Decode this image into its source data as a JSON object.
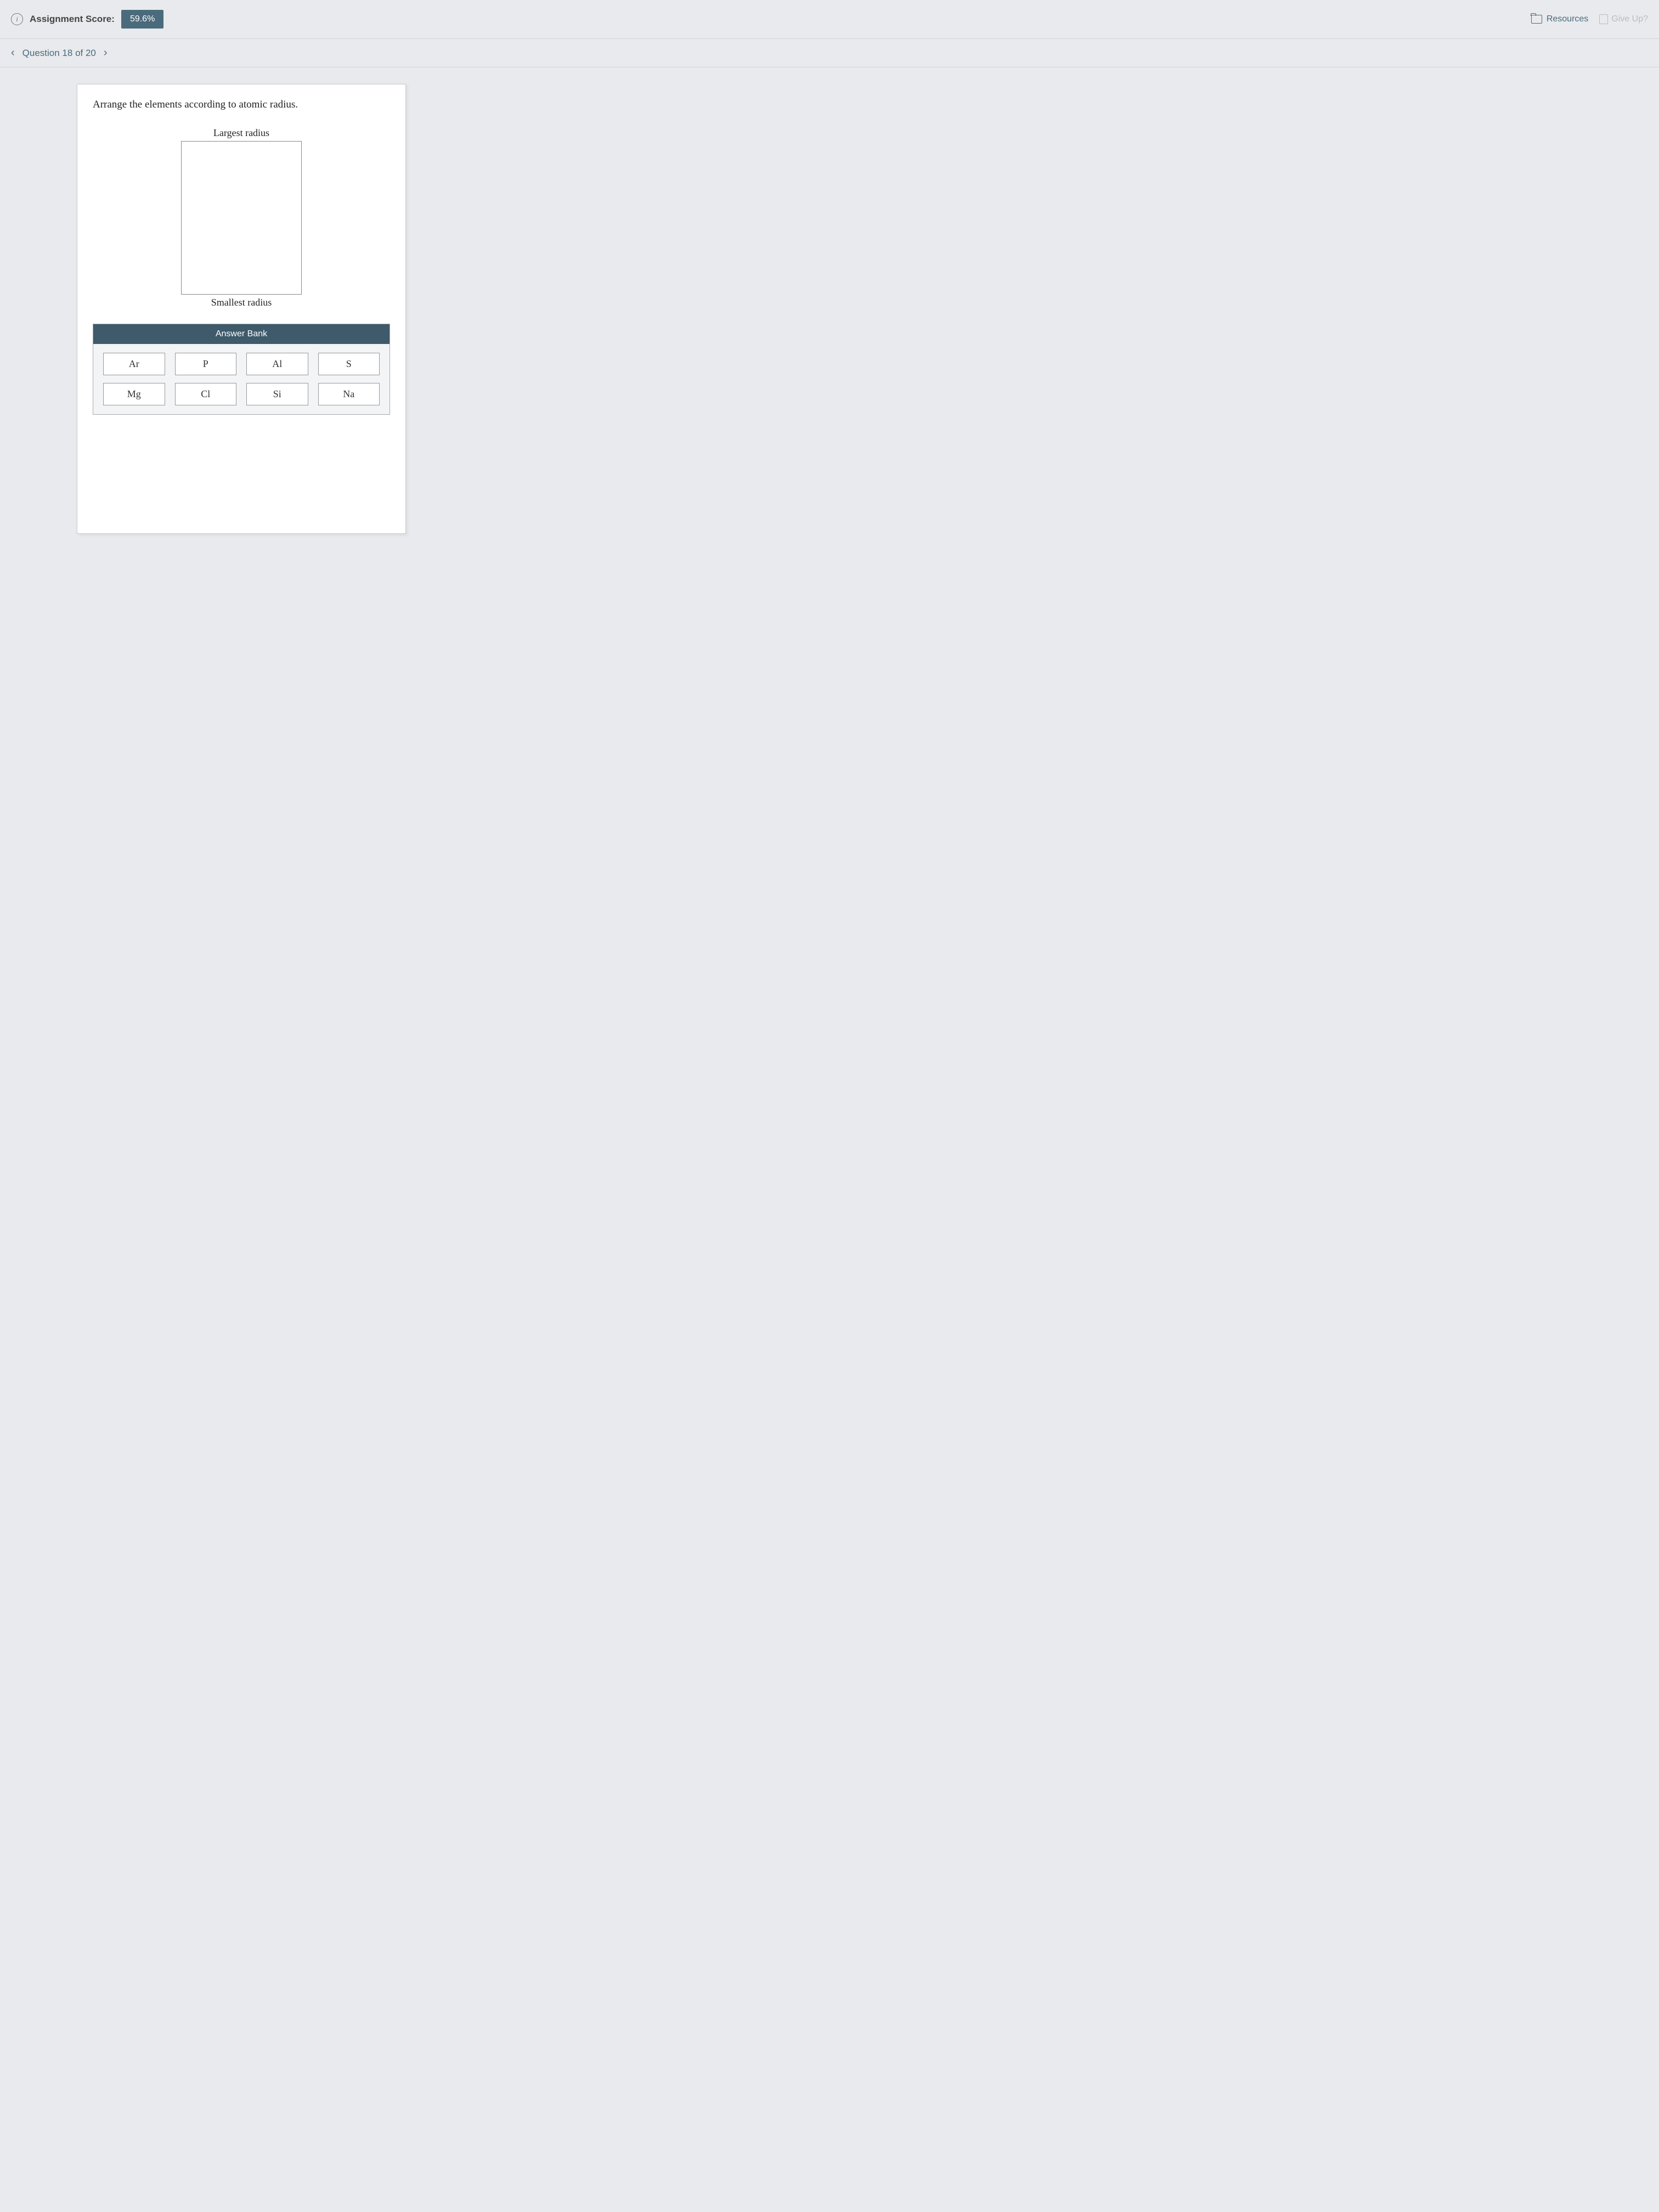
{
  "header": {
    "score_label": "Assignment Score:",
    "score_value": "59.6%",
    "resources_label": "Resources",
    "giveup_label": "Give Up?"
  },
  "nav": {
    "question_label": "Question 18 of 20"
  },
  "question": {
    "prompt": "Arrange the elements according to atomic radius.",
    "top_label": "Largest radius",
    "bottom_label": "Smallest radius",
    "bank_header": "Answer Bank",
    "elements": [
      "Ar",
      "P",
      "Al",
      "S",
      "Mg",
      "Cl",
      "Si",
      "Na"
    ]
  }
}
